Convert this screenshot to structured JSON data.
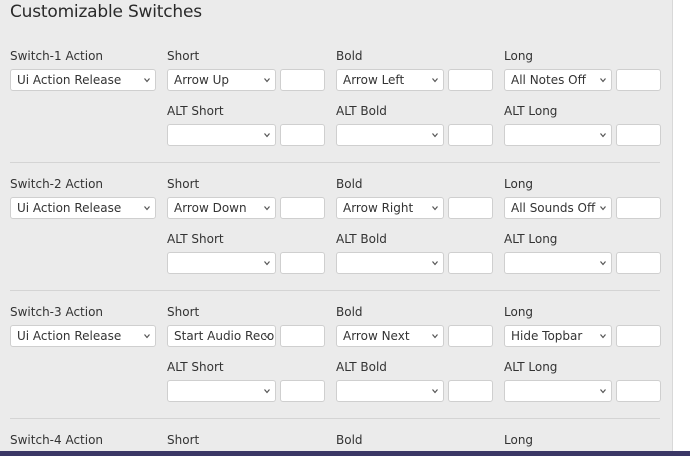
{
  "page": {
    "title": "Customizable Switches"
  },
  "switches": [
    {
      "action_label": "Switch-1 Action",
      "action_value": "Ui Action Release",
      "short_label": "Short",
      "short_value": "Arrow Up",
      "bold_label": "Bold",
      "bold_value": "Arrow Left",
      "long_label": "Long",
      "long_value": "All Notes Off",
      "alt_short_label": "ALT Short",
      "alt_short_value": "",
      "alt_bold_label": "ALT Bold",
      "alt_bold_value": "",
      "alt_long_label": "ALT Long",
      "alt_long_value": ""
    },
    {
      "action_label": "Switch-2 Action",
      "action_value": "Ui Action Release",
      "short_label": "Short",
      "short_value": "Arrow Down",
      "bold_label": "Bold",
      "bold_value": "Arrow Right",
      "long_label": "Long",
      "long_value": "All Sounds Off",
      "alt_short_label": "ALT Short",
      "alt_short_value": "",
      "alt_bold_label": "ALT Bold",
      "alt_bold_value": "",
      "alt_long_label": "ALT Long",
      "alt_long_value": ""
    },
    {
      "action_label": "Switch-3 Action",
      "action_value": "Ui Action Release",
      "short_label": "Short",
      "short_value": "Start Audio Recor",
      "bold_label": "Bold",
      "bold_value": "Arrow Next",
      "long_label": "Long",
      "long_value": "Hide Topbar",
      "alt_short_label": "ALT Short",
      "alt_short_value": "",
      "alt_bold_label": "ALT Bold",
      "alt_bold_value": "",
      "alt_long_label": "ALT Long",
      "alt_long_value": ""
    },
    {
      "action_label": "Switch-4 Action",
      "short_label": "Short",
      "bold_label": "Bold",
      "long_label": "Long"
    }
  ],
  "icons": {
    "select_chevron": "chevron-down-icon"
  },
  "colors": {
    "background": "#ebebeb",
    "field_border": "#cfcfcf",
    "bottom_bar": "#3b3766"
  }
}
